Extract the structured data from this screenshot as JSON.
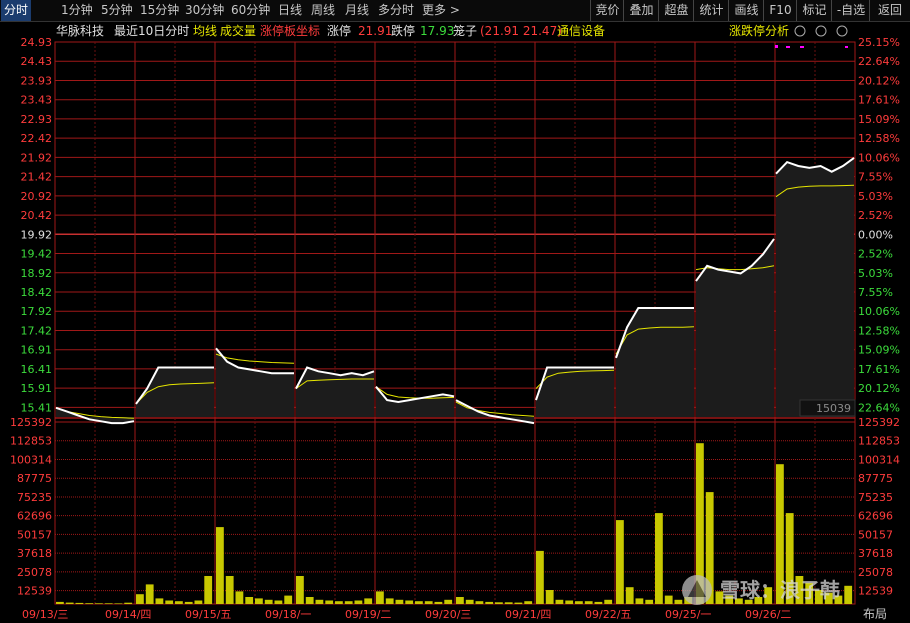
{
  "toolbar": {
    "left": [
      "分时",
      "1分钟",
      "5分钟",
      "15分钟",
      "30分钟",
      "60分钟",
      "日线",
      "周线",
      "月线",
      "多分时",
      "更多 >"
    ],
    "right": [
      "竞价",
      "叠加",
      "超盘",
      "统计",
      "画线",
      "F10",
      "标记",
      "-自选",
      "返回"
    ]
  },
  "colors": {
    "bg": "#000000",
    "grid": "#a01818",
    "price": "#ffffff",
    "avg": "#e6e600",
    "volume": "#c8c800",
    "up": "#ff3c3c",
    "down": "#3cdc3c",
    "neutral": "#e0e0e0",
    "cyan": "#00e0e0",
    "magenta": "#ff00ff",
    "active_tab": "#1b3c6e"
  },
  "header": {
    "stock": "华脉科技",
    "period": "最近10日分时",
    "avg_label": "均线",
    "volume_label": "成交量",
    "limit_axis_label": "涨停板坐标",
    "limit_up_label": "涨停",
    "limit_up_value": "21.91",
    "limit_down_label": "跌停",
    "limit_down_value": "17.93",
    "cage_label": "笼子",
    "cage_value": "(21.91 21.47)",
    "sector": "通信设备",
    "analysis_button": "涨跌停分析"
  },
  "left_axis": [
    "24.93",
    "24.43",
    "23.93",
    "23.43",
    "22.93",
    "22.42",
    "21.92",
    "21.42",
    "20.92",
    "20.42",
    "19.92",
    "19.42",
    "18.92",
    "18.42",
    "17.92",
    "17.42",
    "16.91",
    "16.41",
    "15.91",
    "15.41"
  ],
  "right_axis": [
    "25.15%",
    "22.64%",
    "20.12%",
    "17.61%",
    "15.09%",
    "12.58%",
    "10.06%",
    "7.55%",
    "5.03%",
    "2.52%",
    "0.00%",
    "2.52%",
    "5.03%",
    "7.55%",
    "10.06%",
    "12.58%",
    "15.09%",
    "17.61%",
    "20.12%",
    "22.64%"
  ],
  "vol_axis": [
    "125392",
    "112853",
    "100314",
    "87775",
    "75235",
    "62696",
    "50157",
    "37618",
    "25078",
    "12539"
  ],
  "vol_box_value": "15039",
  "x_labels": [
    "09/13/三",
    "09/14/四",
    "09/15/五",
    "09/18/一",
    "09/19/二",
    "09/20/三",
    "09/21/四",
    "09/22/五",
    "09/25/一",
    "09/26/二"
  ],
  "bottom_right": "布局",
  "watermark": "雪球：浪子韩",
  "chart_data": {
    "type": "line",
    "x": [
      "09/13/三",
      "09/14/四",
      "09/15/五",
      "09/18/一",
      "09/19/二",
      "09/20/三",
      "09/21/四",
      "09/22/五",
      "09/25/一",
      "09/26/二"
    ],
    "ylim": [
      15.16,
      24.93
    ],
    "prev_close": 19.92,
    "series": [
      {
        "name": "price",
        "values": [
          [
            15.4,
            15.3,
            15.2,
            15.1,
            15.05,
            15.0,
            15.0,
            15.05
          ],
          [
            15.5,
            15.9,
            16.45,
            16.45,
            16.45,
            16.45,
            16.45,
            16.45
          ],
          [
            16.95,
            16.6,
            16.45,
            16.4,
            16.35,
            16.3,
            16.3,
            16.3
          ],
          [
            15.9,
            16.45,
            16.35,
            16.3,
            16.25,
            16.3,
            16.25,
            16.35
          ],
          [
            15.95,
            15.6,
            15.55,
            15.6,
            15.65,
            15.7,
            15.75,
            15.7
          ],
          [
            15.6,
            15.45,
            15.3,
            15.2,
            15.15,
            15.1,
            15.05,
            15.0
          ],
          [
            15.6,
            16.45,
            16.45,
            16.45,
            16.45,
            16.45,
            16.45,
            16.45
          ],
          [
            16.7,
            17.5,
            18.0,
            18.0,
            18.0,
            18.0,
            18.0,
            18.0
          ],
          [
            18.7,
            19.1,
            19.0,
            18.95,
            18.9,
            19.1,
            19.4,
            19.8
          ],
          [
            21.5,
            21.8,
            21.7,
            21.65,
            21.7,
            21.55,
            21.7,
            21.91
          ]
        ]
      },
      {
        "name": "average",
        "values": [
          [
            15.4,
            15.3,
            15.25,
            15.2,
            15.17,
            15.15,
            15.14,
            15.13
          ],
          [
            15.5,
            15.8,
            15.95,
            16.0,
            16.02,
            16.03,
            16.04,
            16.05
          ],
          [
            16.8,
            16.7,
            16.65,
            16.62,
            16.6,
            16.58,
            16.57,
            16.56
          ],
          [
            15.9,
            16.1,
            16.12,
            16.13,
            16.14,
            16.15,
            16.15,
            16.15
          ],
          [
            15.95,
            15.75,
            15.68,
            15.66,
            15.65,
            15.65,
            15.66,
            15.67
          ],
          [
            15.55,
            15.4,
            15.33,
            15.28,
            15.25,
            15.22,
            15.2,
            15.18
          ],
          [
            15.9,
            16.2,
            16.3,
            16.33,
            16.35,
            16.36,
            16.37,
            16.38
          ],
          [
            16.8,
            17.3,
            17.45,
            17.48,
            17.5,
            17.5,
            17.5,
            17.51
          ],
          [
            19.0,
            19.05,
            19.02,
            19.0,
            19.0,
            19.02,
            19.05,
            19.1
          ],
          [
            20.9,
            21.1,
            21.15,
            21.17,
            21.18,
            21.18,
            21.19,
            21.2
          ]
        ]
      },
      {
        "name": "volume",
        "values": [
          [
            1500,
            1000,
            800,
            600,
            500,
            500,
            400,
            900
          ],
          [
            7000,
            14000,
            4000,
            2500,
            2000,
            1500,
            2500,
            20000
          ],
          [
            55000,
            20000,
            9000,
            5000,
            4000,
            3000,
            2500,
            6000
          ],
          [
            20000,
            5000,
            3000,
            2500,
            2000,
            2000,
            2500,
            4000
          ],
          [
            9000,
            4000,
            3000,
            2500,
            2000,
            2000,
            1500,
            3000
          ],
          [
            5000,
            3000,
            2000,
            1500,
            1200,
            1200,
            1000,
            2000
          ],
          [
            38000,
            10000,
            3000,
            2500,
            2000,
            2000,
            1500,
            3000
          ],
          [
            60000,
            12000,
            4000,
            3000,
            65000,
            6000,
            3000,
            5000
          ],
          [
            115000,
            80000,
            9000,
            6000,
            4000,
            3000,
            5000,
            12000
          ],
          [
            100000,
            65000,
            20000,
            15000,
            10000,
            8000,
            6000,
            13000
          ]
        ]
      }
    ]
  }
}
